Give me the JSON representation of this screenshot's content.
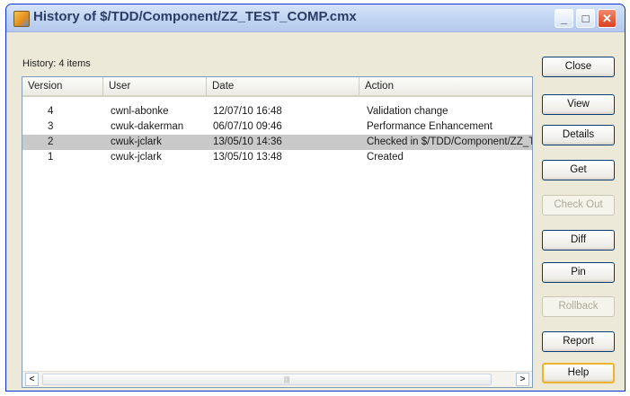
{
  "window": {
    "title": "History of $/TDD/Component/ZZ_TEST_COMP.cmx"
  },
  "history_label": "History: 4 items",
  "columns": [
    "Version",
    "User",
    "Date",
    "Action"
  ],
  "rows": [
    {
      "version": "4",
      "user": "cwnl-abonke",
      "date": "12/07/10 16:48",
      "action": "Validation change",
      "selected": false
    },
    {
      "version": "3",
      "user": "cwuk-dakerman",
      "date": "06/07/10 09:46",
      "action": "Performance Enhancement",
      "selected": false
    },
    {
      "version": "2",
      "user": "cwuk-jclark",
      "date": "13/05/10 14:36",
      "action": "Checked in $/TDD/Component/ZZ_TEST_COMP.cmx",
      "selected": true
    },
    {
      "version": "1",
      "user": "cwuk-jclark",
      "date": "13/05/10 13:48",
      "action": "Created",
      "selected": false
    }
  ],
  "buttons": {
    "close": "Close",
    "view": "View",
    "details": "Details",
    "get": "Get",
    "check_out": "Check Out",
    "diff": "Diff",
    "pin": "Pin",
    "rollback": "Rollback",
    "report": "Report",
    "help": "Help"
  },
  "icons": {
    "app": "source-control-icon",
    "minimize": "minimize-icon",
    "maximize": "maximize-icon",
    "close": "close-icon",
    "scroll_left": "arrow-left-icon",
    "scroll_right": "arrow-right-icon"
  },
  "colors": {
    "title_bar": "#c3d6f2",
    "close_button": "#d9411f",
    "selected_row": "#c9c9c9"
  }
}
